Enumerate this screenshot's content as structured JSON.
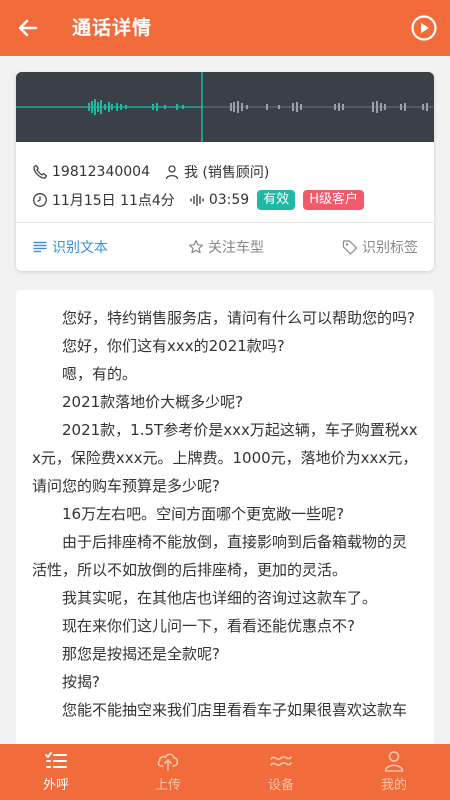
{
  "header": {
    "title": "通话详情"
  },
  "call": {
    "phone": "19812340004",
    "owner": "我 (销售顾问)",
    "datetime": "11月15日 11点4分",
    "duration": "03:59",
    "status_badge": "有效",
    "level_badge": "H级客户"
  },
  "colors": {
    "brand": "#f26b3a",
    "accent": "#3a8fe0",
    "valid": "#1fb8a7",
    "level": "#f05a6a",
    "waveform_bg": "#3a4048",
    "waveform_played": "#1fb8a7"
  },
  "tabs": [
    {
      "label": "识别文本",
      "icon": "list-icon",
      "active": true
    },
    {
      "label": "关注车型",
      "icon": "star-icon",
      "active": false
    },
    {
      "label": "识别标签",
      "icon": "tag-icon",
      "active": false
    }
  ],
  "transcript": [
    "您好，特约销售服务店，请问有什么可以帮助您的吗?",
    "您好，你们这有xxx的2021款吗?",
    "嗯，有的。",
    "2021款落地价大概多少呢?",
    "2021款，1.5T参考价是xxx万起这辆，车子购置税xxx元，保险费xxx元。上牌费。1000元，落地价为xxx元，请问您的购车预算是多少呢?",
    "16万左右吧。空间方面哪个更宽敞一些呢?",
    "由于后排座椅不能放倒，直接影响到后备箱载物的灵活性，所以不如放倒的后排座椅，更加的灵活。",
    "我其实呢，在其他店也详细的咨询过这款车了。",
    "现在来你们这儿问一下，看看还能优惠点不?",
    "那您是按揭还是全款呢?",
    "按揭?",
    "您能不能抽空来我们店里看看车子如果很喜欢这款车"
  ],
  "bottom_nav": [
    {
      "label": "外呼",
      "icon": "checklist-icon",
      "active": true
    },
    {
      "label": "上传",
      "icon": "cloud-upload-icon",
      "active": false
    },
    {
      "label": "设备",
      "icon": "device-icon",
      "active": false
    },
    {
      "label": "我的",
      "icon": "person-icon",
      "active": false
    }
  ]
}
